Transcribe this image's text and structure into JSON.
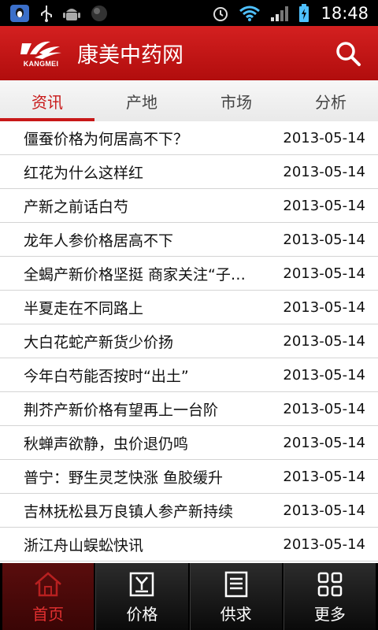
{
  "status_bar": {
    "time": "18:48"
  },
  "header": {
    "logo_text": "KANGMEI",
    "title": "康美中药网"
  },
  "tabs": [
    {
      "label": "资讯",
      "active": true
    },
    {
      "label": "产地",
      "active": false
    },
    {
      "label": "市场",
      "active": false
    },
    {
      "label": "分析",
      "active": false
    }
  ],
  "news": [
    {
      "title": "僵蚕价格为何居高不下？",
      "date": "2013-05-14"
    },
    {
      "title": "红花为什么这样红",
      "date": "2013-05-14"
    },
    {
      "title": "产新之前话白芍",
      "date": "2013-05-14"
    },
    {
      "title": "龙年人参价格居高不下",
      "date": "2013-05-14"
    },
    {
      "title": "全蝎产新价格坚挺 商家关注“子…",
      "date": "2013-05-14"
    },
    {
      "title": "半夏走在不同路上",
      "date": "2013-05-14"
    },
    {
      "title": "大白花蛇产新货少价扬",
      "date": "2013-05-14"
    },
    {
      "title": "今年白芍能否按时“出土”",
      "date": "2013-05-14"
    },
    {
      "title": "荆芥产新价格有望再上一台阶",
      "date": "2013-05-14"
    },
    {
      "title": "秋蝉声欲静，虫价退仍鸣",
      "date": "2013-05-14"
    },
    {
      "title": "普宁：野生灵芝快涨 鱼胶缓升",
      "date": "2013-05-14"
    },
    {
      "title": "吉林抚松县万良镇人参产新持续",
      "date": "2013-05-14"
    },
    {
      "title": "浙江舟山蜈蚣快讯",
      "date": "2013-05-14"
    }
  ],
  "bottom_nav": [
    {
      "label": "首页",
      "icon": "home-icon",
      "active": true
    },
    {
      "label": "价格",
      "icon": "price-icon",
      "active": false
    },
    {
      "label": "供求",
      "icon": "list-icon",
      "active": false
    },
    {
      "label": "更多",
      "icon": "grid-icon",
      "active": false
    }
  ],
  "colors": {
    "brand_red": "#c81818",
    "header_red": "#d42020"
  }
}
